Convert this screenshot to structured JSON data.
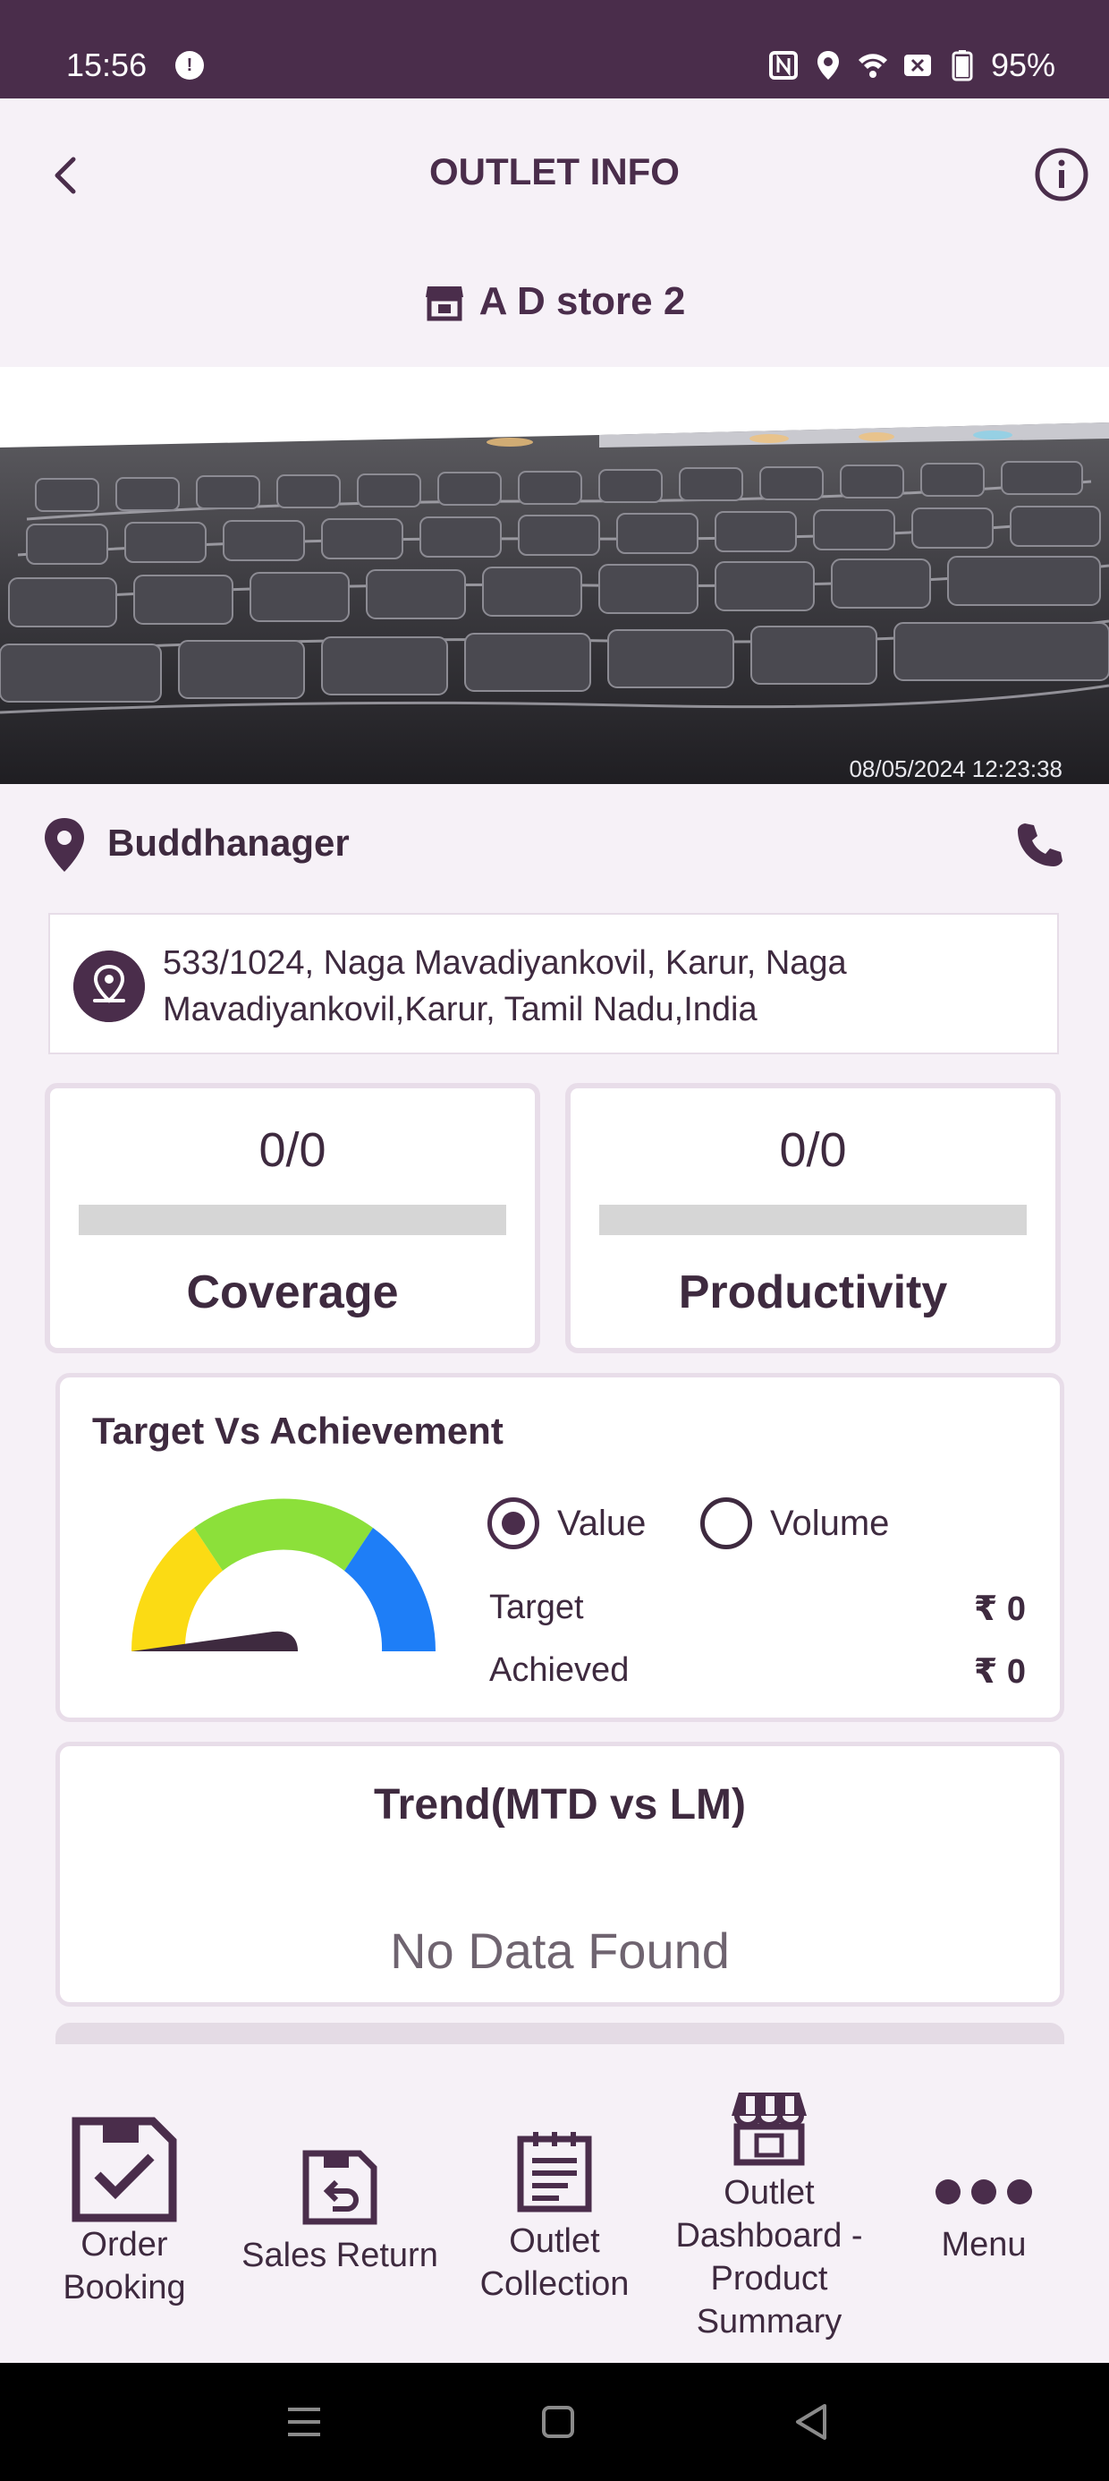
{
  "status_bar": {
    "time": "15:56",
    "battery": "95%"
  },
  "header": {
    "title": "OUTLET INFO",
    "store_name": "A D store 2"
  },
  "photo": {
    "timestamp": "08/05/2024 12:23:38"
  },
  "location": {
    "name": "Buddhanager",
    "address": "533/1024, Naga Mavadiyankovil, Karur, Naga Mavadiyankovil,Karur, Tamil Nadu,India"
  },
  "stats": [
    {
      "value": "0/0",
      "label": "Coverage",
      "progress": 0
    },
    {
      "value": "0/0",
      "label": "Productivity",
      "progress": 0
    }
  ],
  "target_vs_achievement": {
    "title": "Target Vs Achievement",
    "options": [
      {
        "label": "Value",
        "selected": true
      },
      {
        "label": "Volume",
        "selected": false
      }
    ],
    "rows": [
      {
        "label": "Target",
        "value": "₹ 0"
      },
      {
        "label": "Achieved",
        "value": "₹ 0"
      }
    ],
    "gauge_colors": [
      "#fbdb14",
      "#8ce03a",
      "#1e7ef7"
    ]
  },
  "trend": {
    "title": "Trend(MTD vs LM)",
    "empty_text": "No Data Found"
  },
  "bottom_nav": [
    {
      "label": "Order Booking",
      "icon": "order-booking-icon"
    },
    {
      "label": "Sales Return",
      "icon": "sales-return-icon"
    },
    {
      "label": "Outlet Collection",
      "icon": "outlet-collection-icon"
    },
    {
      "label": "Outlet Dashboard -Product Summary",
      "icon": "outlet-dashboard-icon"
    },
    {
      "label": "Menu",
      "icon": "more-dots-icon"
    }
  ],
  "colors": {
    "primary": "#4a2d4b",
    "background": "#f6f1f7"
  }
}
